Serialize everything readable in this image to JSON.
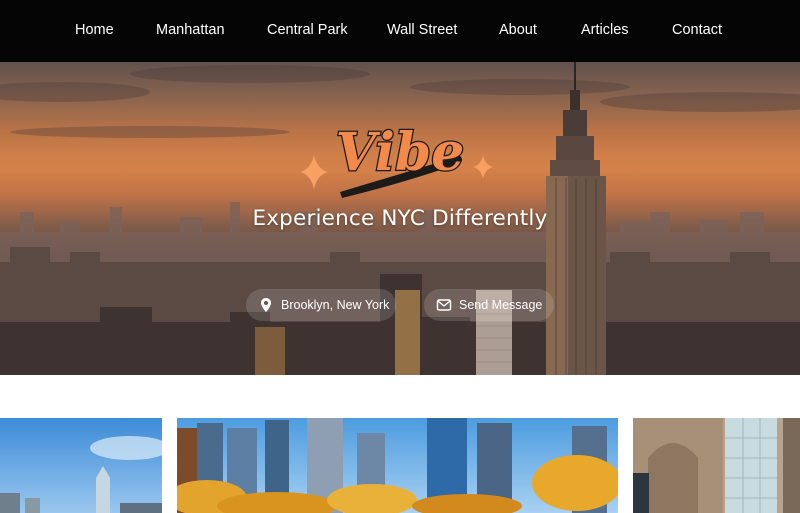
{
  "nav": {
    "items": [
      {
        "label": "Home"
      },
      {
        "label": "Manhattan"
      },
      {
        "label": "Central Park"
      },
      {
        "label": "Wall Street"
      },
      {
        "label": "About"
      },
      {
        "label": "Articles"
      },
      {
        "label": "Contact"
      }
    ]
  },
  "hero": {
    "logo_text": "Vibe",
    "tagline": "Experience NYC Differently",
    "location": {
      "label": "Brooklyn, New York",
      "icon": "map-pin-icon"
    },
    "message": {
      "label": "Send Message",
      "icon": "envelope-icon"
    }
  },
  "colors": {
    "nav_bg": "#050505",
    "logo_orange": "#f28a4c",
    "logo_outline": "#1d1a1a",
    "sparkle": "#f7a064"
  }
}
